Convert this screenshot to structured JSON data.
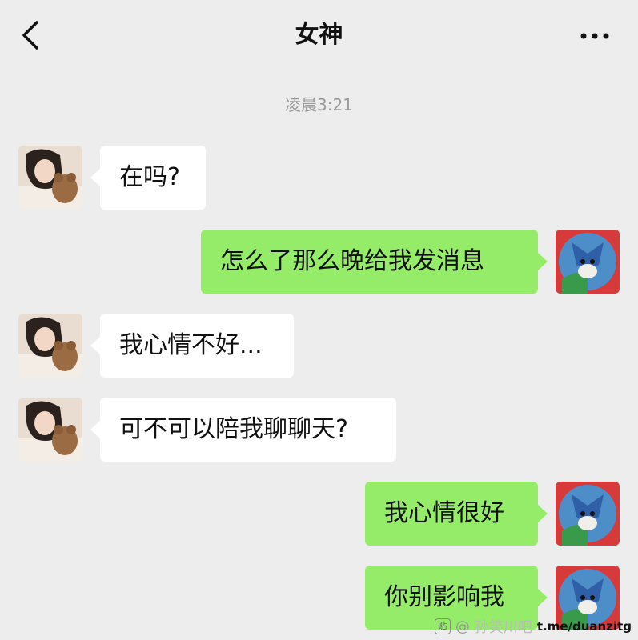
{
  "header": {
    "title": "女神"
  },
  "timestamp": "凌晨3:21",
  "messages": [
    {
      "text": "在吗?"
    },
    {
      "text": "怎么了那么晚给我发消息"
    },
    {
      "text": "我心情不好..."
    },
    {
      "text": "可不可以陪我聊聊天?"
    },
    {
      "text": "我心情很好"
    },
    {
      "text": "你别影响我"
    }
  ],
  "watermark": {
    "badge": "贴",
    "at": "@",
    "handle": "孙笑川吧",
    "link": "t.me/duanzitg"
  },
  "colors": {
    "background": "#ededed",
    "incoming_bubble": "#ffffff",
    "outgoing_bubble": "#95ec69",
    "timestamp": "#9a9a9a"
  },
  "icons": [
    "back-arrow-icon",
    "more-dots-icon"
  ]
}
